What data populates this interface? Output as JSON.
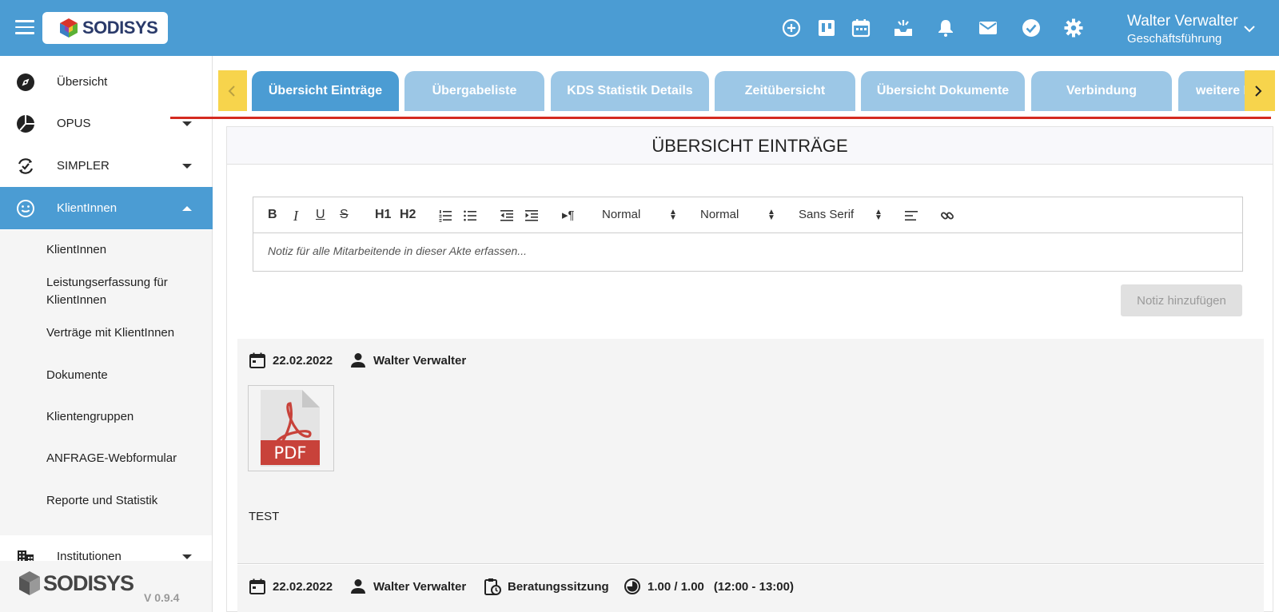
{
  "header": {
    "logo_text": "SODISYS",
    "user_name": "Walter Verwalter",
    "user_role": "Geschäftsführung",
    "icons": [
      "add-circle-icon",
      "board-icon",
      "calendar-icon",
      "inbox-icon",
      "bell-icon",
      "mail-icon",
      "check-circle-icon",
      "gear-icon"
    ]
  },
  "sidebar": {
    "items": [
      {
        "label": "Übersicht",
        "icon": "compass-icon"
      },
      {
        "label": "OPUS",
        "icon": "pie-chart-icon"
      },
      {
        "label": "SIMPLER",
        "icon": "sync-check-icon"
      },
      {
        "label": "KlientInnen",
        "icon": "smiley-icon"
      },
      {
        "label": "Institutionen",
        "icon": "building-icon"
      }
    ],
    "sub_items": [
      "KlientInnen",
      "Leistungserfassung für KlientInnen",
      "Verträge mit KlientInnen",
      "Dokumente",
      "Klientengruppen",
      "ANFRAGE-Webformular",
      "Reporte und Statistik"
    ],
    "footer_logo": "SODISYS",
    "version": "V 0.9.4"
  },
  "tabs": [
    "Übersicht Einträge",
    "Übergabeliste",
    "KDS Statistik Details",
    "Zeitübersicht",
    "Übersicht Dokumente",
    "Verbindung",
    "weitere Infos"
  ],
  "panel": {
    "title": "ÜBERSICHT EINTRÄGE",
    "editor": {
      "header1": "H1",
      "header2": "H2",
      "size_select": "Normal",
      "heading_select": "Normal",
      "font_select": "Sans Serif",
      "placeholder": "Notiz für alle Mitarbeitende in dieser Akte erfassen..."
    },
    "add_note_button": "Notiz hinzufügen",
    "entries": [
      {
        "date": "22.02.2022",
        "author": "Walter Verwalter",
        "attachment_label": "PDF",
        "text": "TEST"
      },
      {
        "date": "22.02.2022",
        "author": "Walter Verwalter",
        "type": "Beratungssitzung",
        "duration": "1.00 / 1.00",
        "time": "(12:00 - 13:00)"
      }
    ]
  },
  "colors": {
    "primary": "#4b9cd3",
    "tab_inactive": "#9cc7e6",
    "scroll_button": "#f7d44c",
    "underline": "#d42a20"
  }
}
